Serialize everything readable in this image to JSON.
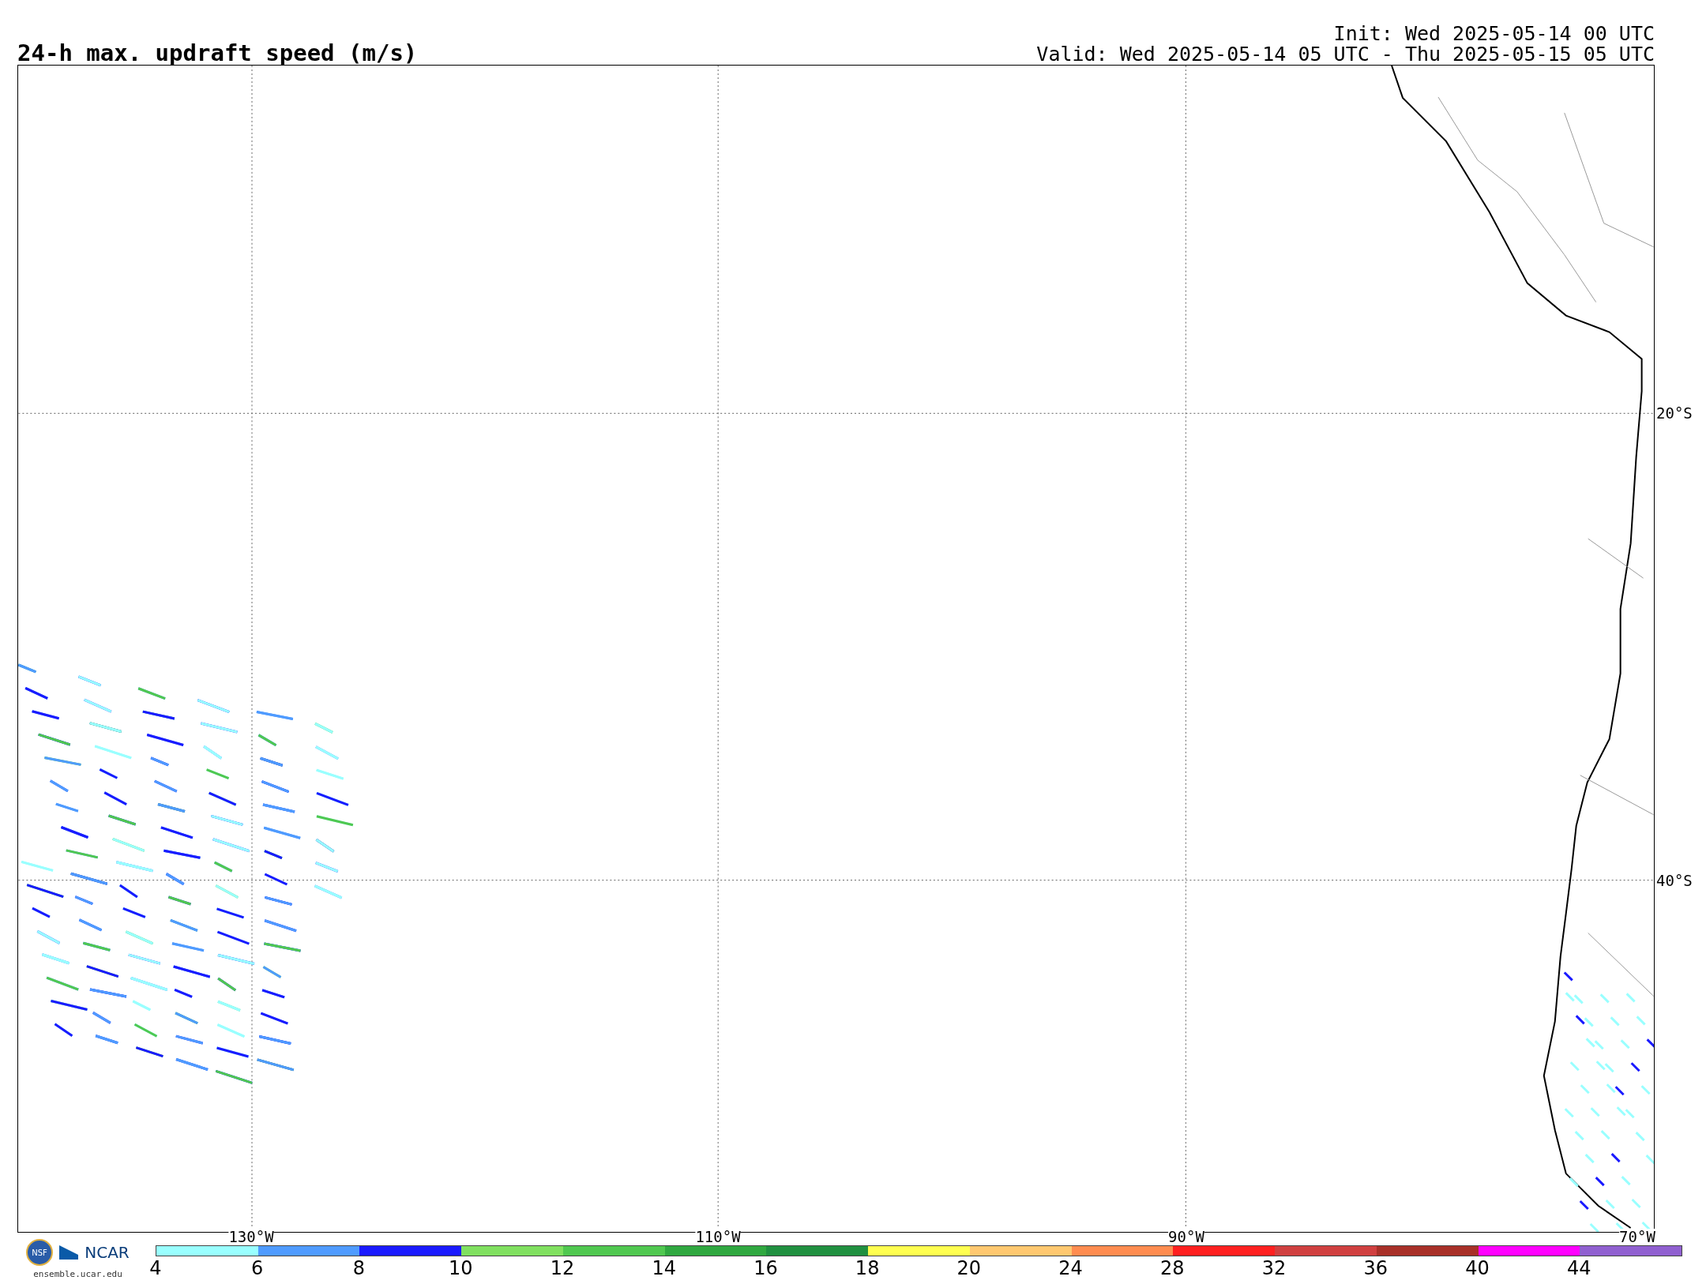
{
  "title": "24-h max. updraft speed (m/s)",
  "init": "Init: Wed 2025-05-14 00 UTC",
  "valid": "Valid: Wed 2025-05-14 05 UTC - Thu 2025-05-15 05 UTC",
  "lat_labels": [
    "20°S",
    "40°S"
  ],
  "lon_labels": [
    "130°W",
    "110°W",
    "90°W",
    "70°W"
  ],
  "logos": {
    "nsf": "NSF",
    "ncar": "NCAR",
    "site": "ensemble.ucar.edu"
  },
  "colorbar": [
    {
      "label": "4",
      "color": "#99ffff"
    },
    {
      "label": "6",
      "color": "#4f9bff"
    },
    {
      "label": "8",
      "color": "#1a1aff"
    },
    {
      "label": "10",
      "color": "#80e060"
    },
    {
      "label": "12",
      "color": "#50c850"
    },
    {
      "label": "14",
      "color": "#30a840"
    },
    {
      "label": "16",
      "color": "#209040"
    },
    {
      "label": "18",
      "color": "#ffff50"
    },
    {
      "label": "20",
      "color": "#ffc870"
    },
    {
      "label": "24",
      "color": "#ff8c50"
    },
    {
      "label": "28",
      "color": "#ff2020"
    },
    {
      "label": "32",
      "color": "#d04040"
    },
    {
      "label": "36",
      "color": "#a83028"
    },
    {
      "label": "40",
      "color": "#ff00ff"
    },
    {
      "label": "44",
      "color": "#9060d0"
    }
  ]
}
